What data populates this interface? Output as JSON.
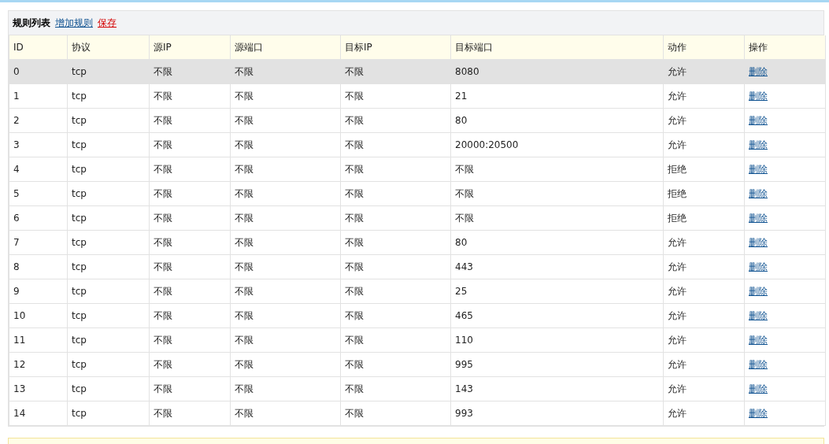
{
  "panel": {
    "title": "规则列表",
    "links": [
      {
        "label": "增加规则",
        "kind": "normal"
      },
      {
        "label": "保存",
        "kind": "warning"
      }
    ]
  },
  "table": {
    "columns": [
      "ID",
      "协议",
      "源IP",
      "源端口",
      "目标IP",
      "目标端口",
      "动作",
      "操作"
    ],
    "rows": [
      {
        "id": "0",
        "protocol": "tcp",
        "src_ip": "不限",
        "src_port": "不限",
        "dst_ip": "不限",
        "dst_port": "8080",
        "action": "允许",
        "op": "删除",
        "selected": true
      },
      {
        "id": "1",
        "protocol": "tcp",
        "src_ip": "不限",
        "src_port": "不限",
        "dst_ip": "不限",
        "dst_port": "21",
        "action": "允许",
        "op": "删除",
        "selected": false
      },
      {
        "id": "2",
        "protocol": "tcp",
        "src_ip": "不限",
        "src_port": "不限",
        "dst_ip": "不限",
        "dst_port": "80",
        "action": "允许",
        "op": "删除",
        "selected": false
      },
      {
        "id": "3",
        "protocol": "tcp",
        "src_ip": "不限",
        "src_port": "不限",
        "dst_ip": "不限",
        "dst_port": "20000:20500",
        "action": "允许",
        "op": "删除",
        "selected": false
      },
      {
        "id": "4",
        "protocol": "tcp",
        "src_ip": "不限",
        "src_port": "不限",
        "dst_ip": "不限",
        "dst_port": "不限",
        "action": "拒绝",
        "op": "删除",
        "selected": false
      },
      {
        "id": "5",
        "protocol": "tcp",
        "src_ip": "不限",
        "src_port": "不限",
        "dst_ip": "不限",
        "dst_port": "不限",
        "action": "拒绝",
        "op": "删除",
        "selected": false
      },
      {
        "id": "6",
        "protocol": "tcp",
        "src_ip": "不限",
        "src_port": "不限",
        "dst_ip": "不限",
        "dst_port": "不限",
        "action": "拒绝",
        "op": "删除",
        "selected": false
      },
      {
        "id": "7",
        "protocol": "tcp",
        "src_ip": "不限",
        "src_port": "不限",
        "dst_ip": "不限",
        "dst_port": "80",
        "action": "允许",
        "op": "删除",
        "selected": false
      },
      {
        "id": "8",
        "protocol": "tcp",
        "src_ip": "不限",
        "src_port": "不限",
        "dst_ip": "不限",
        "dst_port": "443",
        "action": "允许",
        "op": "删除",
        "selected": false
      },
      {
        "id": "9",
        "protocol": "tcp",
        "src_ip": "不限",
        "src_port": "不限",
        "dst_ip": "不限",
        "dst_port": "25",
        "action": "允许",
        "op": "删除",
        "selected": false
      },
      {
        "id": "10",
        "protocol": "tcp",
        "src_ip": "不限",
        "src_port": "不限",
        "dst_ip": "不限",
        "dst_port": "465",
        "action": "允许",
        "op": "删除",
        "selected": false
      },
      {
        "id": "11",
        "protocol": "tcp",
        "src_ip": "不限",
        "src_port": "不限",
        "dst_ip": "不限",
        "dst_port": "110",
        "action": "允许",
        "op": "删除",
        "selected": false
      },
      {
        "id": "12",
        "protocol": "tcp",
        "src_ip": "不限",
        "src_port": "不限",
        "dst_ip": "不限",
        "dst_port": "995",
        "action": "允许",
        "op": "删除",
        "selected": false
      },
      {
        "id": "13",
        "protocol": "tcp",
        "src_ip": "不限",
        "src_port": "不限",
        "dst_ip": "不限",
        "dst_port": "143",
        "action": "允许",
        "op": "删除",
        "selected": false
      },
      {
        "id": "14",
        "protocol": "tcp",
        "src_ip": "不限",
        "src_port": "不限",
        "dst_ip": "不限",
        "dst_port": "993",
        "action": "允许",
        "op": "删除",
        "selected": false
      }
    ]
  }
}
